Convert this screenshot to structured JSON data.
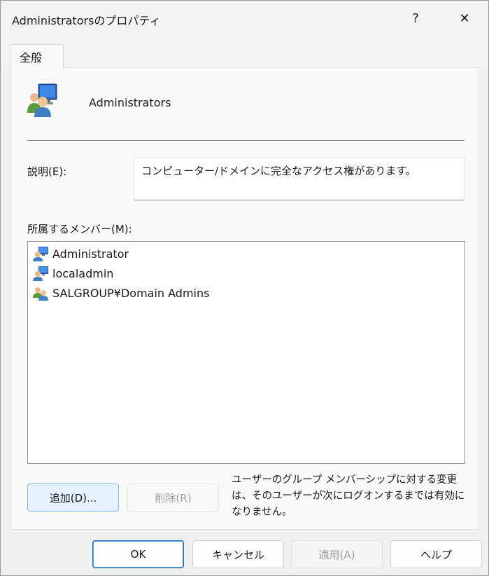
{
  "window": {
    "title": "Administratorsのプロパティ",
    "help_glyph": "?",
    "close_glyph": "✕"
  },
  "tabs": [
    {
      "label": "全般",
      "selected": true
    }
  ],
  "general": {
    "group_name": "Administrators",
    "group_icon": "group-users-icon",
    "description_label": "説明(E):",
    "description_value": "コンピューター/ドメインに完全なアクセス権があります。",
    "members_label": "所属するメンバー(M):",
    "members": [
      {
        "name": "Administrator",
        "icon": "user-computer-icon"
      },
      {
        "name": "localadmin",
        "icon": "user-computer-icon"
      },
      {
        "name": "SALGROUP¥Domain Admins",
        "icon": "domain-group-icon"
      }
    ],
    "add_label": "追加(D)...",
    "remove_label": "削除(R)",
    "note": "ユーザーのグループ メンバーシップに対する変更は、そのユーザーが次にログオンするまでは有効になりません。"
  },
  "footer": {
    "ok_label": "OK",
    "cancel_label": "キャンセル",
    "apply_label": "適用(A)",
    "help_label": "ヘルプ"
  },
  "colors": {
    "accent": "#0067c0",
    "disabled_text": "#a0a0a0",
    "panel_bg": "#f9f9f9"
  }
}
